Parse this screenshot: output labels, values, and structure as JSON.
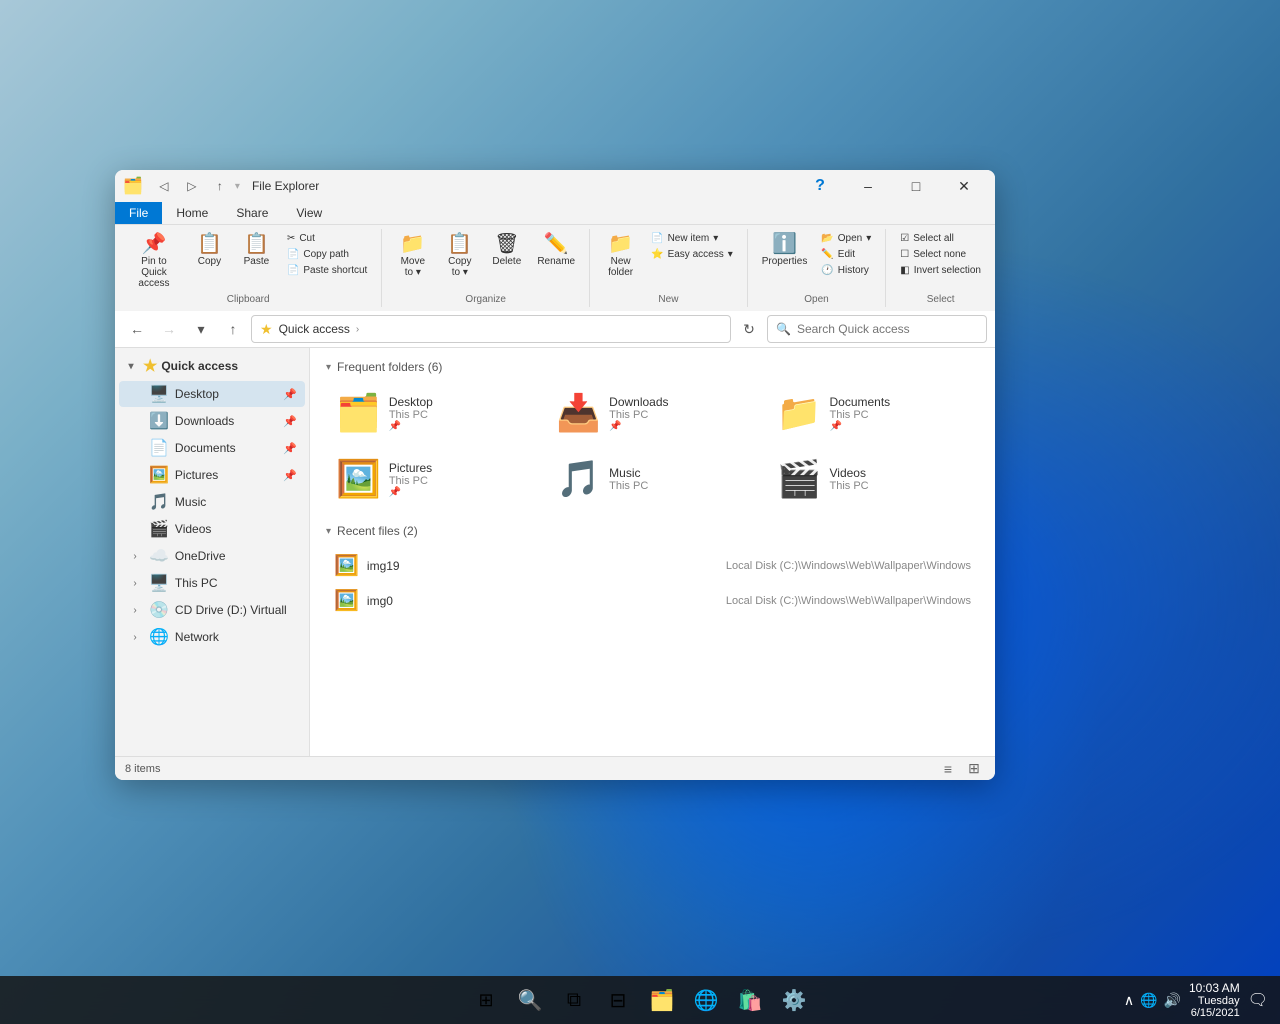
{
  "window": {
    "title": "File Explorer",
    "titleIcon": "🗂️"
  },
  "titlebar": {
    "quickAccessItems": [
      "📌",
      "↩️",
      "→",
      "⬆"
    ],
    "minimizeLabel": "–",
    "maximizeLabel": "□",
    "closeLabel": "✕"
  },
  "ribbon": {
    "tabs": [
      {
        "id": "file",
        "label": "File",
        "active": true
      },
      {
        "id": "home",
        "label": "Home",
        "active": false
      },
      {
        "id": "share",
        "label": "Share",
        "active": false
      },
      {
        "id": "view",
        "label": "View",
        "active": false
      }
    ],
    "groups": {
      "clipboard": {
        "label": "Clipboard",
        "buttons": [
          {
            "id": "pin",
            "icon": "📌",
            "label": "Pin to Quick\naccess"
          },
          {
            "id": "copy",
            "icon": "📋",
            "label": "Copy"
          },
          {
            "id": "paste",
            "icon": "📋",
            "label": "Paste"
          }
        ],
        "smallButtons": [
          {
            "id": "cut",
            "icon": "✂",
            "label": "Cut"
          },
          {
            "id": "copypath",
            "icon": "📄",
            "label": "Copy path"
          },
          {
            "id": "pasteshortcut",
            "icon": "📄",
            "label": "Paste shortcut"
          }
        ]
      },
      "organize": {
        "label": "Organize",
        "buttons": [
          {
            "id": "moveto",
            "icon": "📁",
            "label": "Move\nto"
          },
          {
            "id": "copyto",
            "icon": "📋",
            "label": "Copy\nto"
          },
          {
            "id": "delete",
            "icon": "🗑",
            "label": "Delete"
          },
          {
            "id": "rename",
            "icon": "✏️",
            "label": "Rename"
          }
        ]
      },
      "new": {
        "label": "New",
        "buttons": [
          {
            "id": "newfolder",
            "icon": "📁",
            "label": "New\nfolder"
          }
        ],
        "smallButtons": [
          {
            "id": "newitem",
            "icon": "📄",
            "label": "New item"
          },
          {
            "id": "easyaccess",
            "icon": "⭐",
            "label": "Easy access"
          }
        ]
      },
      "open": {
        "label": "Open",
        "buttons": [
          {
            "id": "properties",
            "icon": "ℹ️",
            "label": "Properties"
          }
        ],
        "smallButtons": [
          {
            "id": "open",
            "icon": "📂",
            "label": "Open"
          },
          {
            "id": "edit",
            "icon": "✏️",
            "label": "Edit"
          },
          {
            "id": "history",
            "icon": "🕐",
            "label": "History"
          }
        ]
      },
      "select": {
        "label": "Select",
        "smallButtons": [
          {
            "id": "selectall",
            "icon": "☑",
            "label": "Select all"
          },
          {
            "id": "selectnone",
            "icon": "☐",
            "label": "Select none"
          },
          {
            "id": "invertselection",
            "icon": "◧",
            "label": "Invert selection"
          }
        ]
      }
    }
  },
  "navbar": {
    "backDisabled": false,
    "forwardDisabled": true,
    "upDisabled": false,
    "addressPath": "Quick access",
    "searchPlaceholder": "Search Quick access"
  },
  "sidebar": {
    "quickAccess": {
      "label": "Quick access",
      "expanded": true,
      "items": [
        {
          "id": "desktop",
          "icon": "🖥️",
          "label": "Desktop",
          "pinned": true
        },
        {
          "id": "downloads",
          "icon": "⬇️",
          "label": "Downloads",
          "pinned": true
        },
        {
          "id": "documents",
          "icon": "📄",
          "label": "Documents",
          "pinned": true
        },
        {
          "id": "pictures",
          "icon": "🖼️",
          "label": "Pictures",
          "pinned": true
        },
        {
          "id": "music",
          "icon": "🎵",
          "label": "Music",
          "pinned": false
        },
        {
          "id": "videos",
          "icon": "🎬",
          "label": "Videos",
          "pinned": false
        }
      ]
    },
    "otherItems": [
      {
        "id": "onedrive",
        "icon": "☁️",
        "label": "OneDrive",
        "expanded": false
      },
      {
        "id": "thispc",
        "icon": "🖥️",
        "label": "This PC",
        "expanded": false
      },
      {
        "id": "cddrive",
        "icon": "💿",
        "label": "CD Drive (D:) Virtuall",
        "expanded": false
      },
      {
        "id": "network",
        "icon": "🌐",
        "label": "Network",
        "expanded": false
      }
    ]
  },
  "content": {
    "frequentFolders": {
      "label": "Frequent folders",
      "count": 6,
      "folders": [
        {
          "id": "desktop",
          "icon": "🖥️",
          "name": "Desktop",
          "path": "This PC",
          "color": "#4fc3f7",
          "pinned": true
        },
        {
          "id": "downloads",
          "icon": "⬇️",
          "name": "Downloads",
          "path": "This PC",
          "color": "#26a69a",
          "pinned": true
        },
        {
          "id": "documents",
          "icon": "📄",
          "name": "Documents",
          "path": "This PC",
          "color": "#78909c",
          "pinned": true
        },
        {
          "id": "pictures",
          "icon": "🖼️",
          "name": "Pictures",
          "path": "This PC",
          "color": "#5c8fd6",
          "pinned": true
        },
        {
          "id": "music",
          "icon": "🎵",
          "name": "Music",
          "path": "This PC",
          "color": "#ef6c00",
          "pinned": false
        },
        {
          "id": "videos",
          "icon": "🎬",
          "name": "Videos",
          "path": "This PC",
          "color": "#7b1fa2",
          "pinned": false
        }
      ]
    },
    "recentFiles": {
      "label": "Recent files",
      "count": 2,
      "files": [
        {
          "id": "img19",
          "icon": "🖼️",
          "name": "img19",
          "path": "Local Disk (C:)\\Windows\\Web\\Wallpaper\\Windows"
        },
        {
          "id": "img0",
          "icon": "🖼️",
          "name": "img0",
          "path": "Local Disk (C:)\\Windows\\Web\\Wallpaper\\Windows"
        }
      ]
    }
  },
  "statusBar": {
    "itemCount": "8 items"
  },
  "taskbar": {
    "startIcon": "⊞",
    "searchIcon": "🔍",
    "taskviewIcon": "⧉",
    "widgetsIcon": "⊟",
    "explorerIcon": "🗂️",
    "edgeIcon": "🌐",
    "storeIcon": "🛍️",
    "settingsIcon": "⚙️",
    "time": "10:03 AM",
    "date": "Tuesday\n6/15/2021"
  }
}
